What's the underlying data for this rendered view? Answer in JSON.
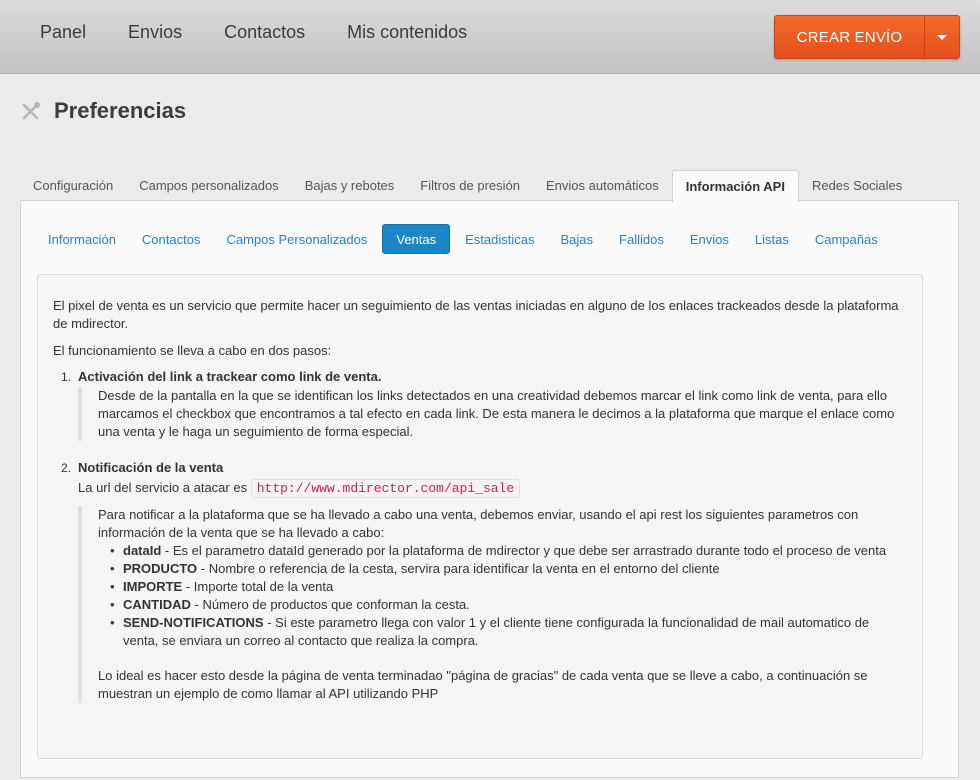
{
  "topnav": {
    "items": [
      "Panel",
      "Envios",
      "Contactos",
      "Mis contenidos"
    ],
    "create_button": "CREAR ENVÍO"
  },
  "page": {
    "title": "Preferencias"
  },
  "tabs": [
    {
      "label": "Configuración",
      "active": false
    },
    {
      "label": "Campos personalizados",
      "active": false
    },
    {
      "label": "Bajas y rebotes",
      "active": false
    },
    {
      "label": "Filtros de presión",
      "active": false
    },
    {
      "label": "Envios automáticos",
      "active": false
    },
    {
      "label": "Información API",
      "active": true
    },
    {
      "label": "Redes Sociales",
      "active": false
    }
  ],
  "subtabs": [
    {
      "label": "Información",
      "active": false
    },
    {
      "label": "Contactos",
      "active": false
    },
    {
      "label": "Campos Personalizados",
      "active": false
    },
    {
      "label": "Ventas",
      "active": true
    },
    {
      "label": "Estadisticas",
      "active": false
    },
    {
      "label": "Bajas",
      "active": false
    },
    {
      "label": "Fallidos",
      "active": false
    },
    {
      "label": "Envios",
      "active": false
    },
    {
      "label": "Listas",
      "active": false
    },
    {
      "label": "Campañas",
      "active": false
    }
  ],
  "content": {
    "intro1": "El pixel de venta es un servicio que permite hacer un seguimiento de las ventas iniciadas en alguno de los enlaces trackeados desde la plataforma de mdirector.",
    "intro2": "El funcionamiento se lleva a cabo en dos pasos:",
    "step1": {
      "num": "1.",
      "title": "Activación del link a trackear como link de venta.",
      "text": "Desde de la pantalla en la que se identifican los links detectados en una creatividad debemos marcar el link como link de venta, para ello marcamos el checkbox que encontramos a tal efecto en cada link. De esta manera le decimos a la plataforma que marque el enlace como una venta y le haga un seguimiento de forma especial."
    },
    "step2": {
      "num": "2.",
      "title": "Notificación de la venta",
      "url_label": "La url del servicio a atacar es",
      "url": "http://www.mdirector.com/api_sale",
      "text": "Para notificar a la plataforma que se ha llevado a cabo una venta, debemos enviar, usando el api rest los siguientes parametros con información de la venta que se ha llevado a cabo:",
      "params": [
        {
          "name": "dataId",
          "desc": " - Es el parametro dataId generado por la plataforma de mdirector y que debe ser arrastrado durante todo el proceso de venta"
        },
        {
          "name": "PRODUCTO",
          "desc": " - Nombre o referencia de la cesta, servira para identificar la venta en el entorno del cliente"
        },
        {
          "name": "IMPORTE",
          "desc": " - Importe total de la venta"
        },
        {
          "name": "CANTIDAD",
          "desc": " - Número de productos que conforman la cesta."
        },
        {
          "name": "SEND-NOTIFICATIONS",
          "desc": " - Si este parametro llega con valor 1 y el cliente tiene configurada la funcionalidad de mail automatico de venta, se enviara un correo al contacto que realiza la compra."
        }
      ],
      "final": "Lo ideal es hacer esto desde la página de venta terminadao \"página de gracias\" de cada venta que se lleve a cabo, a continuación se muestran un ejemplo de como llamar al API utilizando PHP"
    }
  }
}
